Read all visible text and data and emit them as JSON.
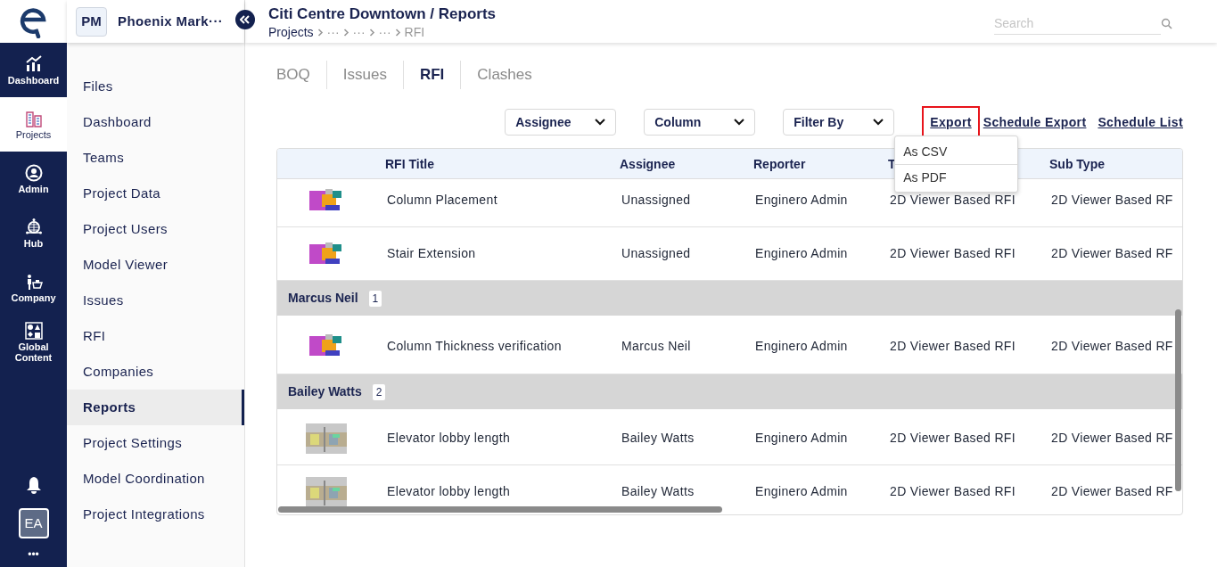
{
  "rail": {
    "items": [
      {
        "label": "Dashboard",
        "kind": "chart",
        "selected": false
      },
      {
        "label": "Projects",
        "kind": "building",
        "selected": true
      },
      {
        "label": "Admin",
        "kind": "user",
        "selected": false
      },
      {
        "label": "Hub",
        "kind": "globe",
        "selected": false
      },
      {
        "label": "Company",
        "kind": "desk",
        "selected": false
      },
      {
        "label": "Global Content",
        "kind": "shapes",
        "selected": false
      }
    ],
    "avatar": "EA",
    "more": "•••"
  },
  "project": {
    "initials": "PM",
    "name": "Phoenix Mark···"
  },
  "header": {
    "title": "Citi Centre Downtown / Reports",
    "breadcrumb": [
      "Projects",
      "···",
      "···",
      "···",
      "RFI"
    ]
  },
  "search": {
    "placeholder": "Search"
  },
  "nav": [
    {
      "label": "Files",
      "selected": false
    },
    {
      "label": "Dashboard",
      "selected": false
    },
    {
      "label": "Teams",
      "selected": false
    },
    {
      "label": "Project Data",
      "selected": false
    },
    {
      "label": "Project Users",
      "selected": false
    },
    {
      "label": "Model Viewer",
      "selected": false
    },
    {
      "label": "Issues",
      "selected": false
    },
    {
      "label": "RFI",
      "selected": false
    },
    {
      "label": "Companies",
      "selected": false
    },
    {
      "label": "Reports",
      "selected": true
    },
    {
      "label": "Project Settings",
      "selected": false
    },
    {
      "label": "Model Coordination",
      "selected": false
    },
    {
      "label": "Project Integrations",
      "selected": false
    }
  ],
  "tabs": [
    {
      "label": "BOQ",
      "selected": false
    },
    {
      "label": "Issues",
      "selected": false
    },
    {
      "label": "RFI",
      "selected": true
    },
    {
      "label": "Clashes",
      "selected": false
    }
  ],
  "filters": [
    "Assignee",
    "Column",
    "Filter By"
  ],
  "actions": [
    {
      "label": "Export",
      "outlined": true
    },
    {
      "label": "Schedule Export",
      "outlined": false
    },
    {
      "label": "Schedule List",
      "outlined": false
    }
  ],
  "export_menu": [
    "As CSV",
    "As PDF"
  ],
  "table": {
    "columns": [
      "RFI Title",
      "Assignee",
      "Reporter",
      "T",
      "Sub Type"
    ],
    "rows": [
      {
        "kind": "rfi",
        "title": "Column Placement",
        "assignee": "Unassigned",
        "reporter": "Enginero Admin",
        "type": "2D Viewer Based RFI",
        "sub_type": "2D Viewer Based RF"
      },
      {
        "kind": "rfi",
        "title": "Stair Extension",
        "assignee": "Unassigned",
        "reporter": "Enginero Admin",
        "type": "2D Viewer Based RFI",
        "sub_type": "2D Viewer Based RF"
      },
      {
        "kind": "group",
        "name": "Marcus Neil",
        "count": "1"
      },
      {
        "kind": "rfi",
        "title": "Column Thickness verification",
        "assignee": "Marcus Neil",
        "reporter": "Enginero Admin",
        "type": "2D Viewer Based RFI",
        "sub_type": "2D Viewer Based RF"
      },
      {
        "kind": "group",
        "name": "Bailey Watts",
        "count": "2"
      },
      {
        "kind": "rfi",
        "title": "Elevator lobby length",
        "assignee": "Bailey Watts",
        "reporter": "Enginero Admin",
        "type": "2D Viewer Based RFI",
        "sub_type": "2D Viewer Based RF"
      },
      {
        "kind": "rfi",
        "title": "Elevator lobby length",
        "assignee": "Bailey Watts",
        "reporter": "Enginero Admin",
        "type": "2D Viewer Based RFI",
        "sub_type": "2D Viewer Based RF"
      }
    ]
  }
}
